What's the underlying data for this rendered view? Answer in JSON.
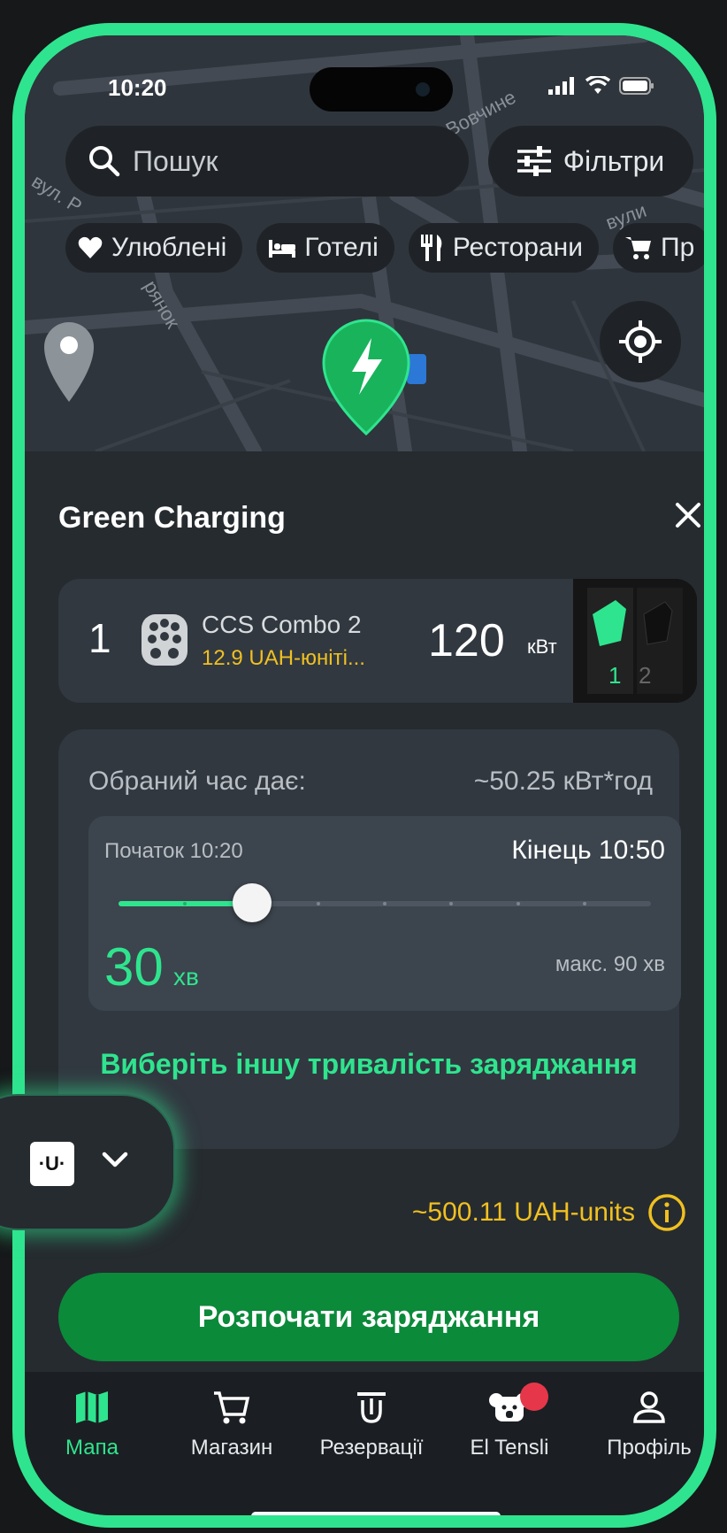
{
  "status_bar": {
    "time": "10:20"
  },
  "map": {
    "search": {
      "placeholder": "Пошук"
    },
    "filters_label": "Фільтри",
    "street_labels": [
      "я Вовчине",
      "вул. Р",
      "рянок",
      "вули"
    ],
    "chips": [
      {
        "icon": "heart-icon",
        "label": "Улюблені"
      },
      {
        "icon": "bed-icon",
        "label": "Готелі"
      },
      {
        "icon": "fork-knife-icon",
        "label": "Ресторани"
      },
      {
        "icon": "cart-icon",
        "label": "Пр"
      }
    ]
  },
  "station": {
    "title": "Green Charging",
    "connector": {
      "number": "1",
      "name": "CCS Combo 2",
      "price": "12.9 UAH-юніті...",
      "power": "120",
      "power_unit": "кВт",
      "image_labels": [
        "1",
        "2"
      ]
    },
    "charging": {
      "gives_label": "Обраний час дає:",
      "gives_value": "~50.25 кВт*год",
      "start_label": "Початок 10:20",
      "end_label": "Кінець 10:50",
      "duration_value": "30",
      "duration_unit": "хв",
      "max_label": "макс. 90 хв",
      "slider_fraction": 0.25,
      "other_duration_link": "Виберіть іншу тривалість заряджання"
    },
    "estimated_price": "~500.11 UAH-units",
    "start_button": "Розпочати заряджання"
  },
  "tabs": [
    {
      "label": "Мапа",
      "icon": "map-icon",
      "active": true
    },
    {
      "label": "Магазин",
      "icon": "cart-icon",
      "active": false
    },
    {
      "label": "Резервації",
      "icon": "reservation-icon",
      "active": false
    },
    {
      "label": "El Tensli",
      "icon": "koala-icon",
      "active": false,
      "badge": true
    },
    {
      "label": "Профіль",
      "icon": "person-icon",
      "active": false
    }
  ],
  "overlay": {
    "logo_text": "·U·"
  },
  "colors": {
    "accent": "#2fe48e",
    "button": "#0b8a3a",
    "price": "#f0c020",
    "badge": "#e6374a"
  }
}
